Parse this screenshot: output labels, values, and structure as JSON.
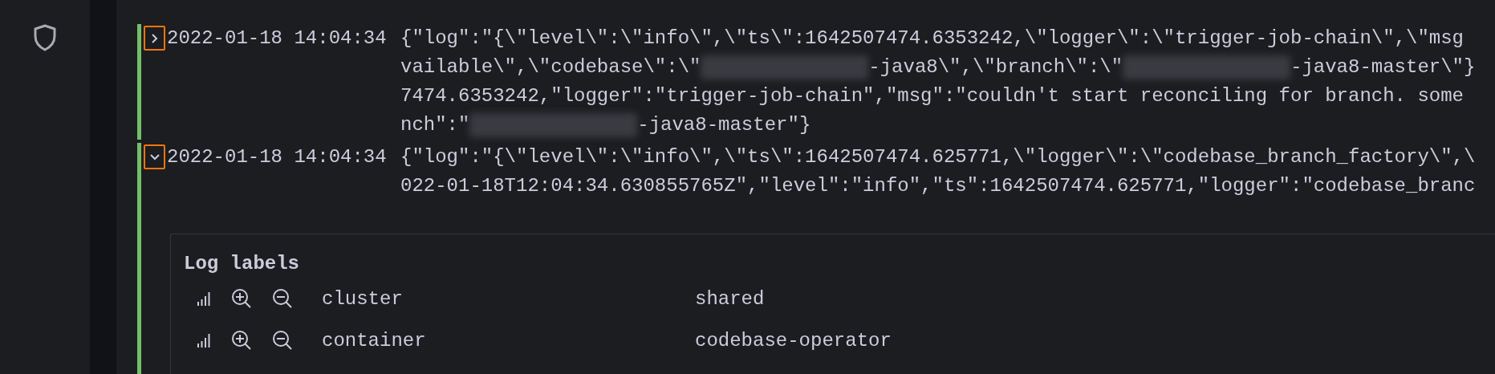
{
  "log_rows": [
    {
      "expanded": false,
      "timestamp": "2022-01-18 14:04:34",
      "lines": [
        [
          {
            "kind": "text",
            "text": "{\"log\":\"{\\\"level\\\":\\\"info\\\",\\\"ts\\\":1642507474.6353242,\\\"logger\\\":\\\"trigger-job-chain\\\",\\\"msg"
          }
        ],
        [
          {
            "kind": "text",
            "text": "vailable\\\",\\\"codebase\\\":\\\""
          },
          {
            "kind": "redacted"
          },
          {
            "kind": "text",
            "text": "-java8\\\",\\\"branch\\\":\\\""
          },
          {
            "kind": "redacted"
          },
          {
            "kind": "text",
            "text": "-java8-master\\\"}"
          }
        ],
        [
          {
            "kind": "text",
            "text": "7474.6353242,\"logger\":\"trigger-job-chain\",\"msg\":\"couldn't start reconciling for branch. some"
          }
        ],
        [
          {
            "kind": "text",
            "text": "nch\":\""
          },
          {
            "kind": "redacted"
          },
          {
            "kind": "text",
            "text": "-java8-master\"}"
          }
        ]
      ]
    },
    {
      "expanded": true,
      "timestamp": "2022-01-18 14:04:34",
      "lines": [
        [
          {
            "kind": "text",
            "text": "{\"log\":\"{\\\"level\\\":\\\"info\\\",\\\"ts\\\":1642507474.625771,\\\"logger\\\":\\\"codebase_branch_factory\\\",\\"
          }
        ],
        [
          {
            "kind": "text",
            "text": "022-01-18T12:04:34.630855765Z\",\"level\":\"info\",\"ts\":1642507474.625771,\"logger\":\"codebase_branc"
          }
        ]
      ]
    }
  ],
  "log_labels": {
    "title": "Log labels",
    "rows": [
      {
        "key": "cluster",
        "value": "shared"
      },
      {
        "key": "container",
        "value": "codebase-operator"
      }
    ]
  }
}
